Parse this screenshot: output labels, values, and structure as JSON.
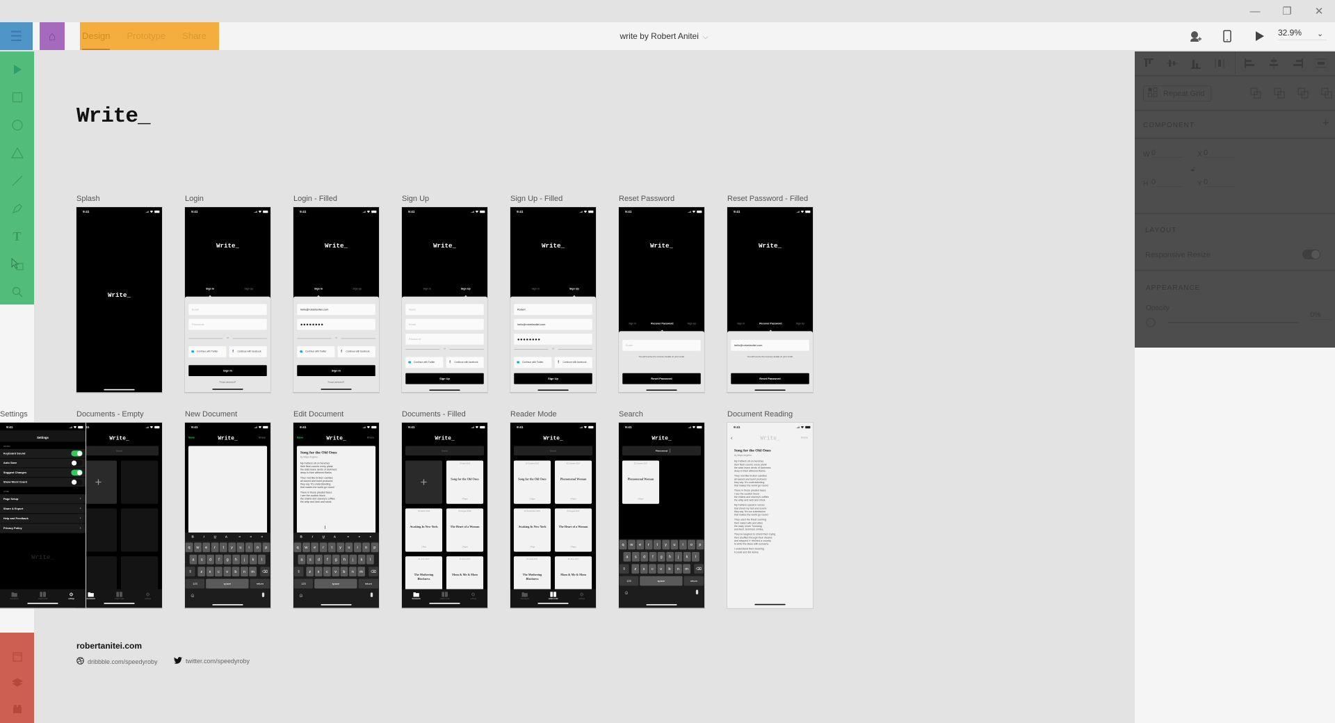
{
  "window": {
    "minimize": "—",
    "restore": "❐",
    "close": "✕"
  },
  "appbar": {
    "menu_icon": "hamburger-menu-icon",
    "home_icon": "home-icon",
    "tabs": [
      {
        "label": "Design",
        "active": true
      },
      {
        "label": "Prototype",
        "active": false
      },
      {
        "label": "Share",
        "active": false
      }
    ],
    "document_title": "write by Robert Anitei",
    "zoom": "32.9%"
  },
  "toolbar": {
    "tools": [
      "select",
      "rectangle",
      "ellipse",
      "polygon",
      "line",
      "pen",
      "text",
      "artboard",
      "zoom"
    ],
    "bottom_tools": [
      "assets",
      "layers",
      "plugins"
    ]
  },
  "inspector": {
    "repeat_grid": "Repeat Grid",
    "component": "COMPONENT",
    "w_label": "W",
    "w": "0",
    "h_label": "H",
    "h": "0",
    "x_label": "X",
    "x": "0",
    "y_label": "Y",
    "y": "0",
    "layout": "LAYOUT",
    "responsive_resize": "Responsive Resize",
    "responsive_resize_on": true,
    "appearance": "APPEARANCE",
    "opacity_label": "Opacity",
    "opacity": "0%"
  },
  "canvas": {
    "title": "Write_",
    "footer": {
      "site": "robertanitei.com",
      "dribbble": "dribbble.com/speedyroby",
      "twitter": "twitter.com/speedyroby"
    }
  },
  "common": {
    "time": "9:41",
    "logo": "Write_",
    "sign_in": "Sign In",
    "sign_up": "Sign Up",
    "recover": "Recover Password",
    "email_ph": "Email",
    "password_ph": "Password",
    "name_ph": "Name",
    "or": "or",
    "twitter": "Continue with Twitter",
    "facebook": "Continue with facebook",
    "forgot": "Forgot password?",
    "reset_btn": "Reset Password",
    "reset_note": "You will receive the recovery details on your email.",
    "email_value": "hello@robertanitei.com",
    "password_value": "●●●●●●●●",
    "name_value": "Robert",
    "search_ph": "Search",
    "save": "Save",
    "share": "Share",
    "tabbar": [
      "documents",
      "reader mode",
      "settings"
    ],
    "format": [
      "B",
      "I",
      "U",
      "A",
      "≡",
      "≡",
      "≡"
    ],
    "keys": [
      [
        "q",
        "w",
        "e",
        "r",
        "t",
        "y",
        "u",
        "i",
        "o",
        "p"
      ],
      [
        "a",
        "s",
        "d",
        "f",
        "g",
        "h",
        "j",
        "k",
        "l"
      ],
      [
        "⇧",
        "z",
        "x",
        "c",
        "v",
        "b",
        "n",
        "m",
        "⌫"
      ]
    ],
    "key_123": "123",
    "key_space": "space",
    "key_return": "return"
  },
  "poem": {
    "title": "Song for the Old Ones",
    "author": "by Maya Angelou",
    "stanzas": [
      [
        "My Fathers sit on benches",
        "their flesh counts every plank",
        "the slats leave dents of darkness",
        "deep in their withered flanks."
      ],
      [
        "They nod like broken candles",
        "all waxed and burnt profound",
        "they say 'It's understanding",
        "that makes the world go round.'"
      ],
      [
        "There in those pleated faces",
        "I see the auction block",
        "the chains and slavery's coffles",
        "the whip and lash and stock."
      ],
      [
        "My Fathers speak in voices",
        "that shred my fact and sound",
        "they say 'It's our submission",
        "that makes the world go round.'"
      ],
      [
        "They used the finest cunning",
        "their naked wits and wiles",
        "the lowly Uncle Tomming",
        "and Aunt Jemima's smiles."
      ],
      [
        "They've laughed to shield their crying",
        "then shuffled through their dreams",
        "and stepped 'n' fetched a country",
        "to write the blues with screams."
      ],
      [
        "I understand their meaning",
        "it could and did derive"
      ]
    ]
  },
  "artboards": [
    {
      "label": "Splash",
      "type": "splash"
    },
    {
      "label": "Login",
      "type": "login",
      "filled": false
    },
    {
      "label": "Login - Filled",
      "type": "login",
      "filled": true
    },
    {
      "label": "Sign Up",
      "type": "signup",
      "filled": false
    },
    {
      "label": "Sign Up - Filled",
      "type": "signup",
      "filled": true
    },
    {
      "label": "Reset Password",
      "type": "reset",
      "filled": false
    },
    {
      "label": "Reset Password - Filled",
      "type": "reset",
      "filled": true
    },
    {
      "label": "Documents - Empty",
      "type": "docs",
      "active_tab": 0,
      "cards": []
    },
    {
      "label": "New Document",
      "type": "edit",
      "content": false
    },
    {
      "label": "Edit Document",
      "type": "edit",
      "content": true
    },
    {
      "label": "Documents - Filled",
      "type": "docs",
      "active_tab": 0,
      "add_card": true,
      "cards": [
        {
          "date": "12 April 2019",
          "title": "Song for the Old Ones",
          "pages": "4 Pages"
        },
        {
          "date": "19 March 2019",
          "title": "Awaking In New York",
          "pages": "1 Page"
        },
        {
          "date": "03 August 2018",
          "title": "The Heart of a Woman",
          "pages": "3 Pages"
        },
        {
          "date": "21 June 2017",
          "title": "The Mothering Blackness",
          "pages": ""
        },
        {
          "date": "12 June 2017",
          "title": "Mom & Me & Mom",
          "pages": ""
        }
      ]
    },
    {
      "label": "Reader Mode",
      "type": "docs",
      "active_tab": 1,
      "add_card": false,
      "cards": [
        {
          "date": "12 October 2017",
          "title": "Song for the Old Ones",
          "pages": "2 Pages"
        },
        {
          "date": "02 October 2017",
          "title": "Phenomenal Woman",
          "pages": "4 Pages"
        },
        {
          "date": "18 September 2019",
          "title": "Awaking In New York",
          "pages": "1 Page"
        },
        {
          "date": "03 August 2017",
          "title": "The Heart of a Woman",
          "pages": "3 Pages"
        },
        {
          "date": "21 June 2017",
          "title": "The Mothering Blackness",
          "pages": ""
        },
        {
          "date": "12 June 2017",
          "title": "Mom & Me & Mom",
          "pages": ""
        }
      ]
    },
    {
      "label": "Search",
      "type": "search",
      "query": "Phenomenal",
      "cards": [
        {
          "date": "02 October 2017",
          "title": "Phenomenal Woman",
          "pages": "4 Pages"
        }
      ]
    },
    {
      "label": "Document Reading",
      "type": "reading"
    },
    {
      "label": "Settings",
      "type": "settings",
      "title": "Settings",
      "writing_header": "WRITING",
      "other_header": "OTHER",
      "toggles": [
        {
          "label": "Keyboard Sound",
          "on": true
        },
        {
          "label": "Auto Save",
          "on": false
        },
        {
          "label": "Suggest Changes",
          "on": true
        },
        {
          "label": "Show Word Count",
          "on": false
        }
      ],
      "links": [
        "Page Setup",
        "Share & Export",
        "Help and Feedback",
        "Privacy Policy"
      ]
    }
  ],
  "colors": {
    "menu": "#4f95c8",
    "home": "#a569bd",
    "mode_tabs": "#f4ae3e",
    "tools": "#52bd7b",
    "bottom_tools": "#cd5f52",
    "green": "#34c759"
  }
}
